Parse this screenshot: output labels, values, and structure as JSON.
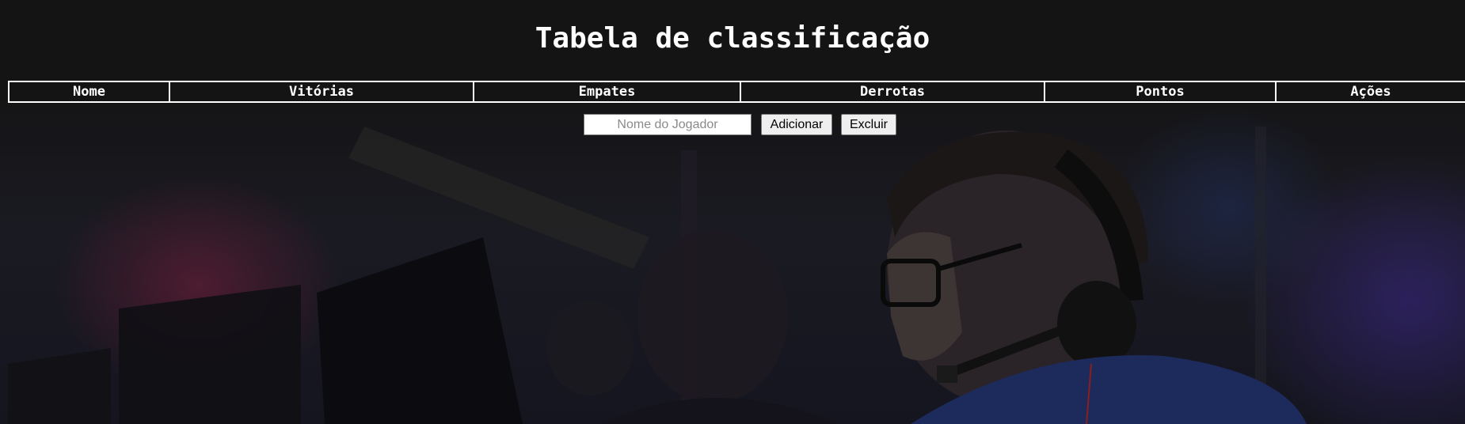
{
  "page": {
    "title": "Tabela de classificação"
  },
  "table": {
    "headers": [
      "Nome",
      "Vitórias",
      "Empates",
      "Derrotas",
      "Pontos",
      "Ações"
    ]
  },
  "form": {
    "player_placeholder": "Nome do Jogador",
    "player_value": "",
    "add_label": "Adicionar",
    "delete_label": "Excluir"
  },
  "colors": {
    "background": "#141414",
    "text": "#ffffff",
    "table_border": "#ffffff",
    "button_bg": "#efefef"
  }
}
